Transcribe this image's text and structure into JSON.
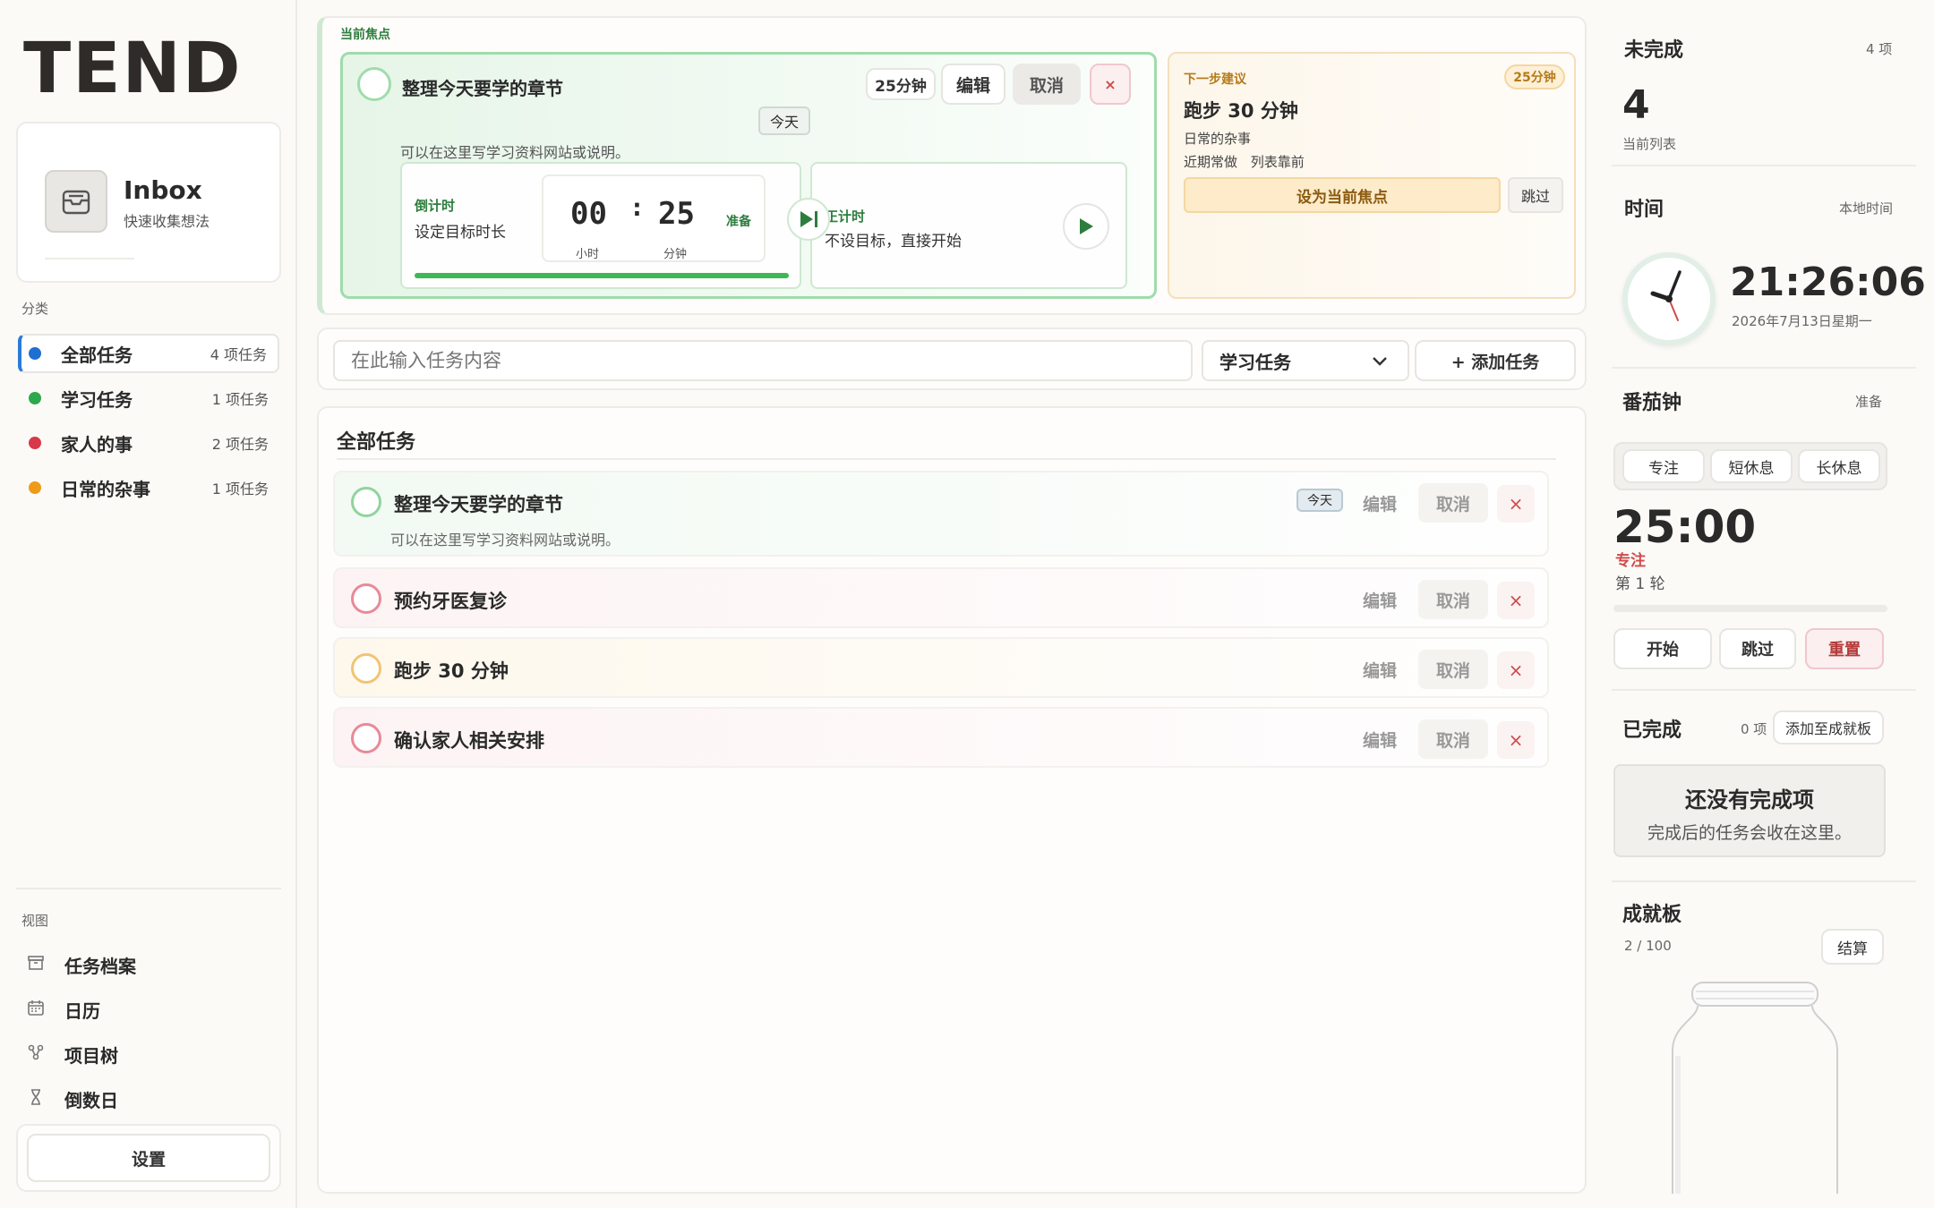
{
  "brand": "TEND",
  "inbox": {
    "title": "Inbox",
    "subtitle": "快速收集想法"
  },
  "categories_label": "分类",
  "categories": [
    {
      "label": "全部任务",
      "count": "4 项任务",
      "color": "#1f6fd1"
    },
    {
      "label": "学习任务",
      "count": "1 项任务",
      "color": "#2ea84a"
    },
    {
      "label": "家人的事",
      "count": "2 项任务",
      "color": "#d83848"
    },
    {
      "label": "日常的杂事",
      "count": "1 项任务",
      "color": "#f09a1a"
    }
  ],
  "views_label": "视图",
  "views": [
    {
      "label": "任务档案",
      "icon": "archive-icon"
    },
    {
      "label": "日历",
      "icon": "calendar-icon"
    },
    {
      "label": "项目树",
      "icon": "tree-icon"
    },
    {
      "label": "倒数日",
      "icon": "hourglass-icon"
    }
  ],
  "settings_label": "设置",
  "focus": {
    "header": "当前焦点",
    "title": "整理今天要学的章节",
    "duration": "25分钟",
    "edit": "编辑",
    "cancel": "取消",
    "close": "×",
    "tag": "今天",
    "note": "可以在这里写学习资料网站或说明。",
    "countdown_label": "倒计时",
    "countdown_desc": "设定目标时长",
    "hours": "00",
    "minutes": "25",
    "colon": ":",
    "hours_label": "小时",
    "minutes_label": "分钟",
    "ready": "准备",
    "stopwatch_label": "正计时",
    "stopwatch_desc": "不设目标，直接开始"
  },
  "suggestion": {
    "header": "下一步建议",
    "badge": "25分钟",
    "title": "跑步 30 分钟",
    "category": "日常的杂事",
    "meta1": "近期常做",
    "meta2": "列表靠前",
    "set_focus": "设为当前焦点",
    "skip": "跳过"
  },
  "add": {
    "placeholder": "在此输入任务内容",
    "category": "学习任务",
    "button": "+ 添加任务"
  },
  "list": {
    "title": "全部任务",
    "edit": "编辑",
    "cancel": "取消",
    "close": "×",
    "tasks": [
      {
        "title": "整理今天要学的章节",
        "tag": "今天",
        "note": "可以在这里写学习资料网站或说明。",
        "color": "#54b96a"
      },
      {
        "title": "预约牙医复诊",
        "color": "#e46a7a"
      },
      {
        "title": "跑步 30 分钟",
        "color": "#f0b64a"
      },
      {
        "title": "确认家人相关安排",
        "color": "#e46a7a"
      }
    ]
  },
  "incomplete": {
    "title": "未完成",
    "count": "4 项",
    "value": "4",
    "sub": "当前列表"
  },
  "clock": {
    "title": "时间",
    "sub": "本地时间",
    "time": "21:26:06",
    "date": "2026年7月13日星期一"
  },
  "pomodoro": {
    "title": "番茄钟",
    "status": "准备",
    "modes": [
      "专注",
      "短休息",
      "长休息"
    ],
    "time": "25:00",
    "mode": "专注",
    "round": "第 1 轮",
    "progress": 0,
    "start": "开始",
    "skip": "跳过",
    "reset": "重置"
  },
  "done": {
    "title": "已完成",
    "count": "0 项",
    "add": "添加至成就板",
    "empty_title": "还没有完成项",
    "empty_desc": "完成后的任务会收在这里。"
  },
  "board": {
    "title": "成就板",
    "progress": "2 / 100",
    "settle": "结算"
  }
}
